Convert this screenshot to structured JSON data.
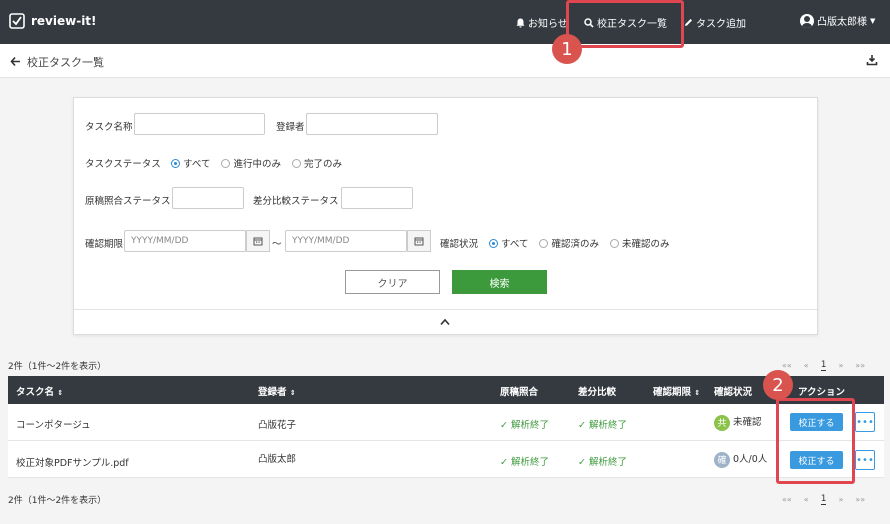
{
  "nav": {
    "brand": "review-it!",
    "notice": "お知らせ",
    "tasks": "校正タスク一覧",
    "add": "タスク追加",
    "user": "凸版太郎様"
  },
  "subheader": {
    "back_icon": "arrow-left-icon",
    "title": "校正タスク一覧",
    "download_icon": "download-icon"
  },
  "search": {
    "task_name_label": "タスク名称",
    "task_name_value": "",
    "registrant_label": "登録者",
    "registrant_value": "",
    "status_label": "タスクステータス",
    "status_options": [
      "すべて",
      "進行中のみ",
      "完了のみ"
    ],
    "status_selected": "すべて",
    "manuscript_label": "原稿照合ステータス",
    "manuscript_value": "",
    "diff_label": "差分比較ステータス",
    "diff_value": "",
    "deadline_label": "確認期限",
    "deadline_from_placeholder": "YYYY/MM/DD",
    "deadline_to_placeholder": "YYYY/MM/DD",
    "range_sep": "～",
    "confirm_label": "確認状況",
    "confirm_options": [
      "すべて",
      "確認済のみ",
      "未確認のみ"
    ],
    "confirm_selected": "すべて",
    "clear_label": "クリア",
    "search_label": "検索",
    "collapse_icon": "chevron-up-icon"
  },
  "results": {
    "count_text": "2件（1件～2件を表示）",
    "pager": {
      "first": "«« ",
      "prev": "«",
      "current": "1",
      "next": "»",
      "last": "»»"
    },
    "columns": [
      "タスク名",
      "登録者",
      "原稿照合",
      "差分比較",
      "確認期限",
      "確認状況",
      "アクション"
    ],
    "rows": [
      {
        "name": "コーンポタージュ",
        "registrant": "凸版花子",
        "manuscript": "解析終了",
        "diff": "解析終了",
        "deadline": "",
        "badge": "共",
        "badge_color": "#8bc34a",
        "confirm": "未確認",
        "action": "校正する"
      },
      {
        "name": "校正対象PDFサンプル.pdf",
        "registrant": "凸版太郎",
        "manuscript": "解析終了",
        "diff": "解析終了",
        "deadline": "",
        "badge": "確",
        "badge_color": "#9fb3c8",
        "confirm": "0人/0人",
        "action": "校正する"
      }
    ]
  },
  "annotations": {
    "one": "1",
    "two": "2"
  },
  "colors": {
    "nav_bg": "#343a40",
    "search_btn": "#3c9a3c",
    "action_btn": "#3a9ae0",
    "highlight": "#e0464f"
  }
}
